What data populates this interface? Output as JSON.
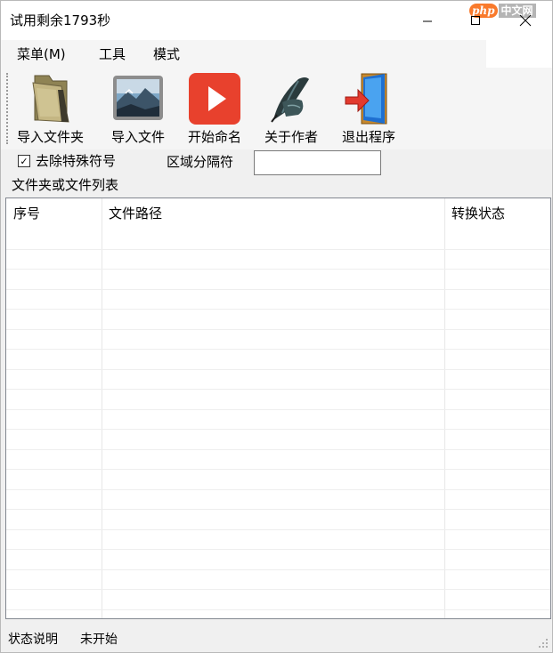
{
  "window": {
    "title": "试用剩余1793秒"
  },
  "watermark": {
    "logo": "php",
    "site": "中文网"
  },
  "menu": {
    "items": [
      {
        "label": "菜单(M)"
      },
      {
        "label": "工具"
      },
      {
        "label": "模式"
      }
    ]
  },
  "toolbar": {
    "buttons": [
      {
        "label": "导入文件夹",
        "icon": "folder-icon"
      },
      {
        "label": "导入文件",
        "icon": "image-file-icon"
      },
      {
        "label": "开始命名",
        "icon": "play-icon"
      },
      {
        "label": "关于作者",
        "icon": "quill-pen-icon"
      },
      {
        "label": "退出程序",
        "icon": "exit-door-icon"
      }
    ]
  },
  "options": {
    "remove_special": {
      "label": "去除特殊符号",
      "checked": true,
      "mark": "☑"
    },
    "separator": {
      "label": "区域分隔符",
      "value": ""
    }
  },
  "list": {
    "group_label": "文件夹或文件列表",
    "columns": [
      {
        "label": "序号"
      },
      {
        "label": "文件路径"
      },
      {
        "label": "转换状态"
      }
    ],
    "rows": []
  },
  "status": {
    "label": "状态说明",
    "value": "未开始"
  },
  "colors": {
    "play_red": "#e8412d",
    "exit_blue": "#1e6fd0",
    "folder_khaki": "#b5a772",
    "list_border": "#828790"
  }
}
